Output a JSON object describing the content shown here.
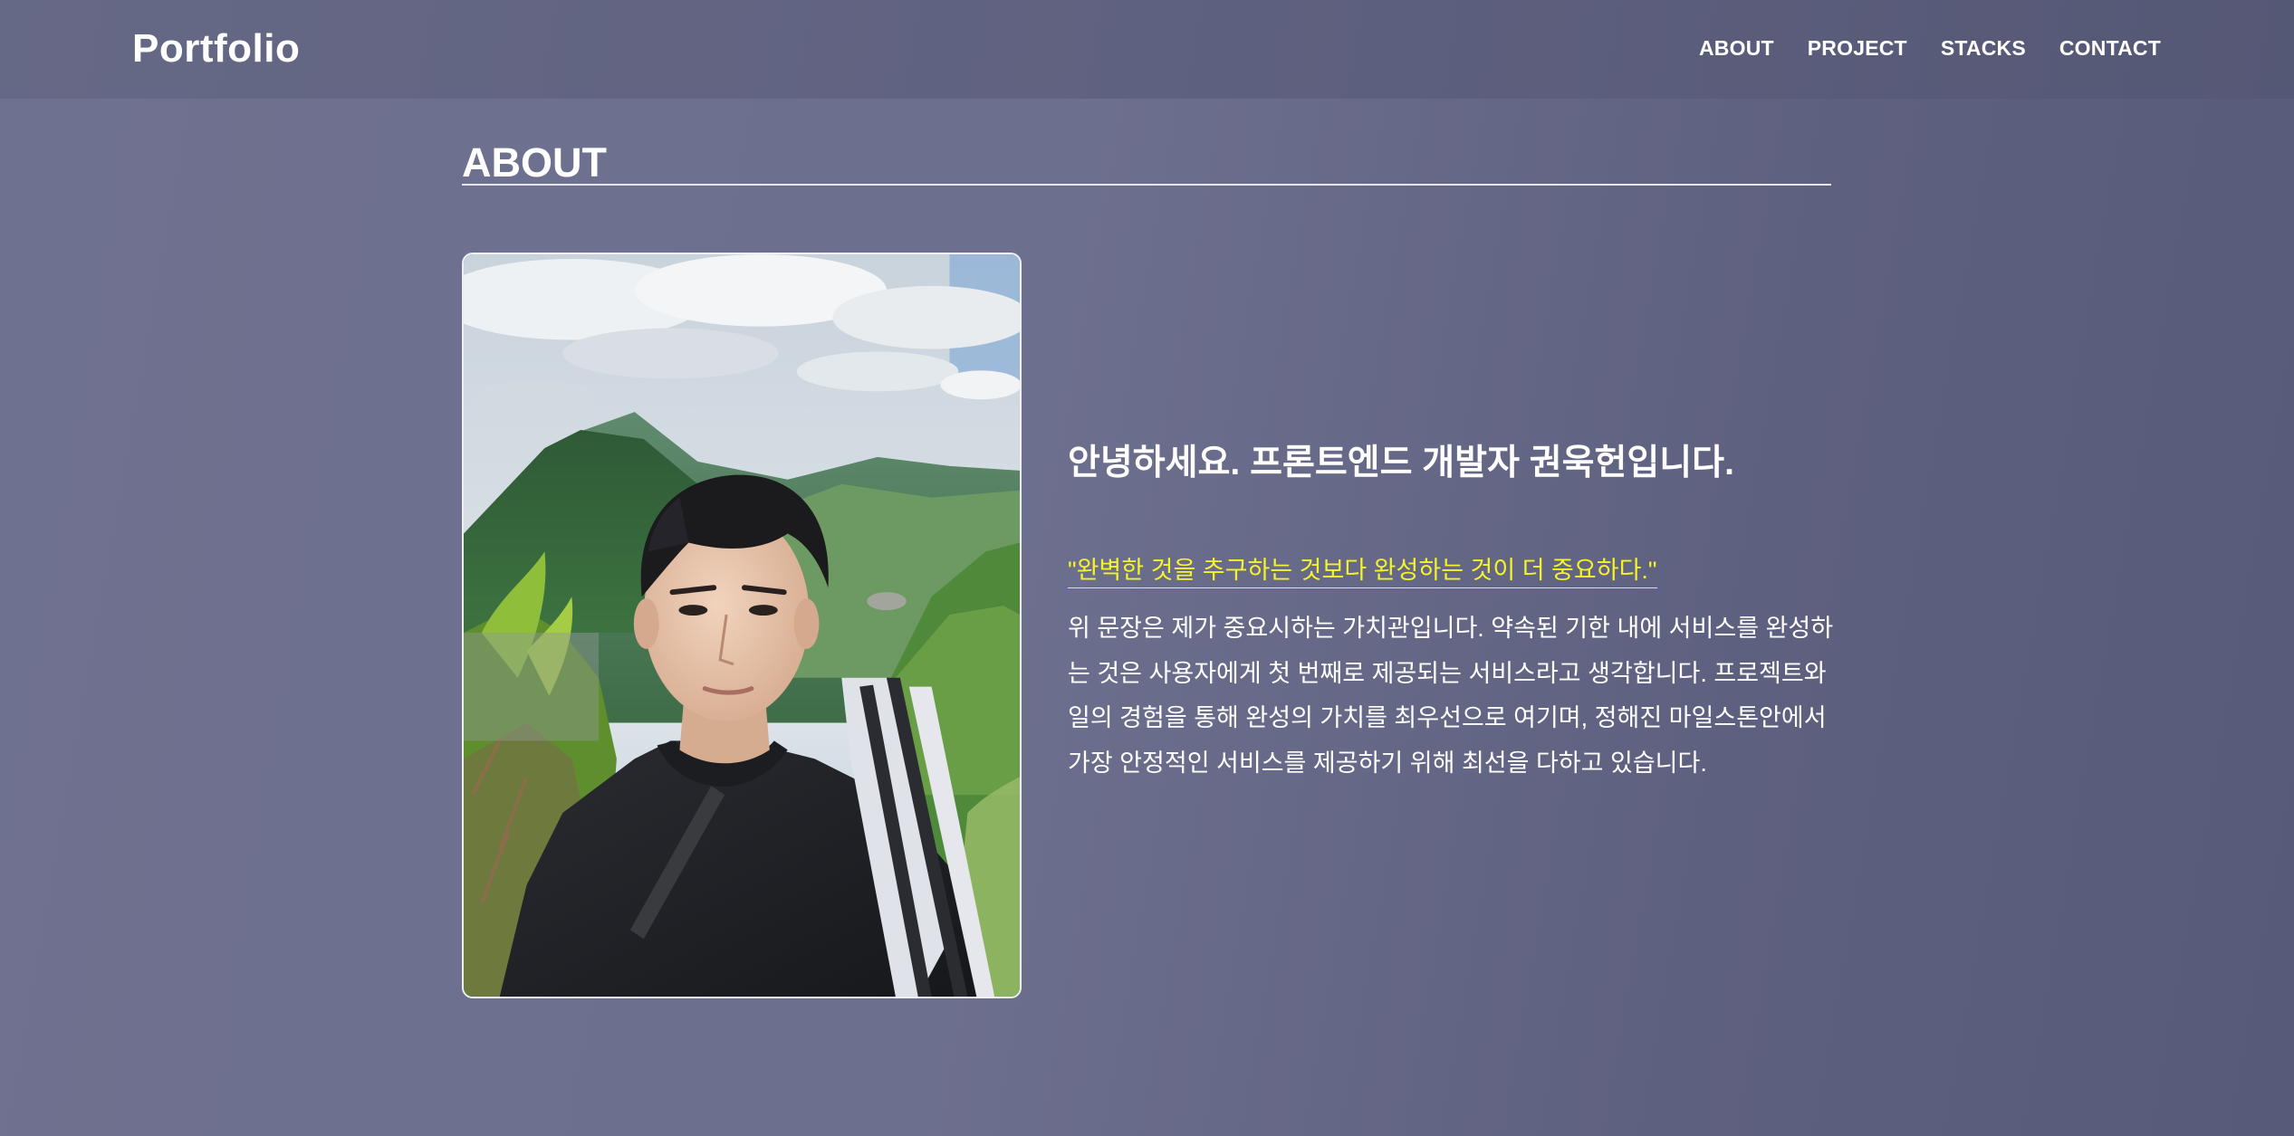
{
  "header": {
    "brand": "Portfolio",
    "nav": [
      "ABOUT",
      "PROJECT",
      "STACKS",
      "CONTACT"
    ]
  },
  "about": {
    "title": "ABOUT",
    "photo_icon": "profile-photo",
    "heading": "안녕하세요. 프론트엔드 개발자 권욱헌입니다.",
    "motto": "\"완벽한 것을 추구하는 것보다 완성하는 것이 더 중요하다.\"",
    "body": "위 문장은 제가 중요시하는 가치관입니다. 약속된 기한 내에 서비스를 완성하는 것은 사용자에게 첫 번째로 제공되는 서비스라고 생각합니다. 프로젝트와 일의 경험을 통해 완성의 가치를 최우선으로 여기며, 정해진 마일스톤안에서 가장 안정적인 서비스를 제공하기 위해 최선을 다하고 있습니다."
  },
  "colors": {
    "background": "#6c6f8d",
    "navbar": "#5f6180",
    "text": "#ffffff",
    "accent_motto": "#f4f428"
  }
}
